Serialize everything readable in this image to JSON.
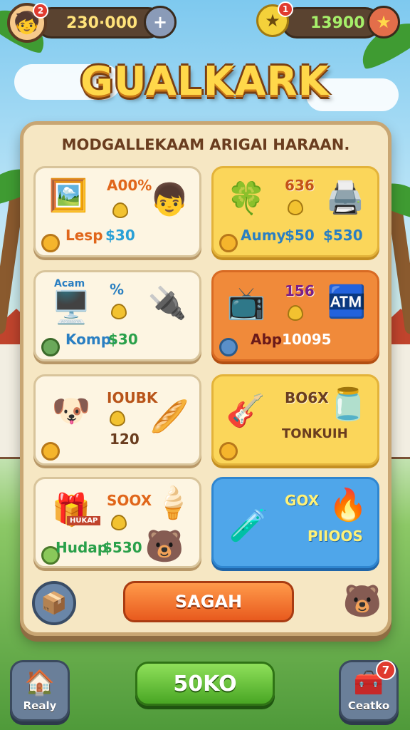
{
  "hud": {
    "avatar_notification": "2",
    "coins": "230·000",
    "gems": "13900",
    "gem_notification": "1"
  },
  "title": "GUALKARK",
  "panel": {
    "heading": "MODGALLEKAAM ARIGAI HARAAN."
  },
  "cards": [
    {
      "pct": "A00%",
      "label": "Lesp",
      "price": "$30"
    },
    {
      "pct": "636",
      "label": "Aumy",
      "price": "$50",
      "price2": "$530"
    },
    {
      "pct": "%",
      "label": "Komp.",
      "price": "$30",
      "art_text": "Acam"
    },
    {
      "pct": "156",
      "label": "Abp",
      "price": "10095"
    },
    {
      "pct": "IOUBK",
      "price": "120"
    },
    {
      "pct": "BO6X",
      "label": "TONKUIH"
    },
    {
      "pct": "SOOX",
      "label": "Hudap",
      "price": "$530",
      "art_text": "HUKAP"
    },
    {
      "pct": "GOX",
      "label": "PIIOOS"
    }
  ],
  "actions": {
    "search_label": "SAGAH",
    "play_label": "50KO"
  },
  "bottom_nav": {
    "left_label": "Realy",
    "right_label": "Ceatko",
    "right_badge": "7"
  },
  "colors": {
    "accent_orange": "#e85a1e",
    "accent_green": "#49a624",
    "title_yellow": "#ffd84a"
  }
}
